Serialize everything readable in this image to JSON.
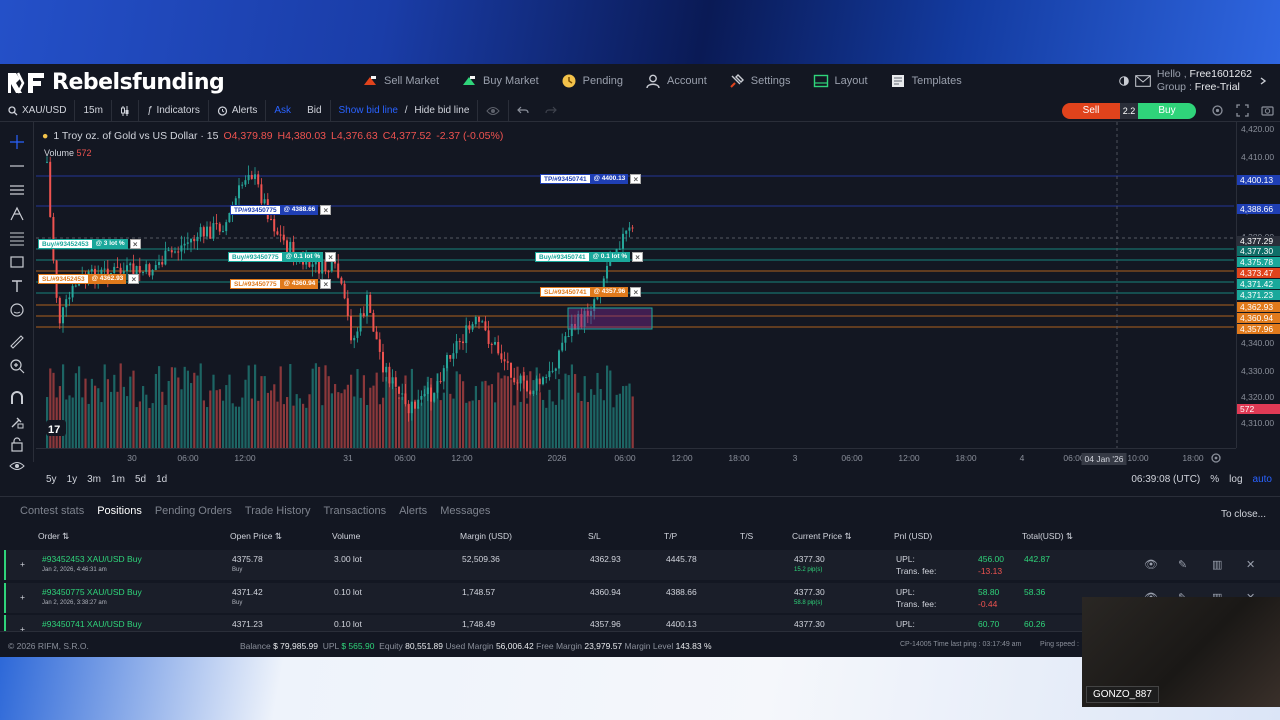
{
  "brand": {
    "name": "Rebelsfunding",
    "accent": "#2962ff"
  },
  "nav": [
    {
      "label": "Sell Market",
      "icon": "sell-market-icon"
    },
    {
      "label": "Buy Market",
      "icon": "buy-market-icon"
    },
    {
      "label": "Pending",
      "icon": "pending-icon"
    },
    {
      "label": "Account",
      "icon": "account-icon"
    },
    {
      "label": "Settings",
      "icon": "settings-icon"
    },
    {
      "label": "Layout",
      "icon": "layout-icon"
    },
    {
      "label": "Templates",
      "icon": "templates-icon"
    }
  ],
  "user": {
    "hello_label": "Hello , ",
    "name": "Free1601262",
    "group_label": "Group : ",
    "group": "Free-Trial"
  },
  "toolbar": {
    "symbol": "XAU/USD",
    "interval": "15m",
    "indicators": "Indicators",
    "alerts": "Alerts",
    "ask": "Ask",
    "bid": "Bid",
    "show_bid_line": "Show bid line",
    "separator": " / ",
    "hide_bid_line": "Hide bid line",
    "sell": "Sell",
    "spread": "2.2",
    "buy": "Buy"
  },
  "chart_header": {
    "title": "1 Troy oz. of Gold vs US Dollar · 15",
    "open": "O4,379.89",
    "high": "H4,380.03",
    "low": "L4,376.63",
    "close": "C4,377.52",
    "change": "-2.37 (-0.05%)",
    "volume_label": "Volume",
    "volume_value": "572"
  },
  "price_axis": {
    "ticks": [
      "4,420.00",
      "4,410.00",
      "4,390.00",
      "4,380.00",
      "4,340.00",
      "4,330.00",
      "4,320.00",
      "4,310.00"
    ],
    "tags": [
      {
        "text": "4,400.13",
        "color": "#1f3fb4"
      },
      {
        "text": "4,388.66",
        "color": "#1f3fb4"
      },
      {
        "text": "4,377.29",
        "color": "#2a2e39"
      },
      {
        "text": "4,377.30",
        "color": "#0f6e68"
      },
      {
        "text": "4,375.78",
        "color": "#1aa89b"
      },
      {
        "text": "4,373.47",
        "color": "#e0431c"
      },
      {
        "text": "4,371.42",
        "color": "#1aa89b"
      },
      {
        "text": "4,371.23",
        "color": "#1aa89b"
      },
      {
        "text": "4,362.93",
        "color": "#e07a1c"
      },
      {
        "text": "4,360.94",
        "color": "#e07a1c"
      },
      {
        "text": "4,357.96",
        "color": "#e07a1c"
      },
      {
        "text": "572",
        "color": "#e03a55"
      }
    ],
    "bid_label": "Bid"
  },
  "time_axis": {
    "ticks": [
      "30",
      "06:00",
      "12:00",
      "31",
      "06:00",
      "12:00",
      "2026",
      "06:00",
      "12:00",
      "18:00",
      "3",
      "06:00",
      "12:00",
      "18:00",
      "4",
      "06:00",
      "10:00",
      "18:00"
    ],
    "crosshair_label": "04 Jan '26"
  },
  "order_lines": [
    {
      "label": "TP/#93450741",
      "value": "@ 4400.13",
      "color": "#1f3fb4"
    },
    {
      "label": "TP/#93450775",
      "value": "@ 4388.66",
      "color": "#1f3fb4"
    },
    {
      "label": "Buy/#93452453",
      "value": "@ 3 lot %",
      "color": "#1aa89b"
    },
    {
      "label": "Buy/#93450775",
      "value": "@ 0.1 lot %",
      "color": "#1aa89b"
    },
    {
      "label": "Buy/#93450741",
      "value": "@ 0.1 lot %",
      "color": "#1aa89b"
    },
    {
      "label": "SL/#93452453",
      "value": "@ 4362.93",
      "color": "#e07a1c"
    },
    {
      "label": "SL/#93450775",
      "value": "@ 4360.94",
      "color": "#e07a1c"
    },
    {
      "label": "SL/#93450741",
      "value": "@ 4357.96",
      "color": "#e07a1c"
    }
  ],
  "range_bar": {
    "ranges": [
      "5y",
      "1y",
      "3m",
      "1m",
      "5d",
      "1d"
    ],
    "clock": "06:39:08 (UTC)",
    "percent": "%",
    "log": "log",
    "auto": "auto"
  },
  "panel": {
    "tabs": [
      "Contest stats",
      "Positions",
      "Pending Orders",
      "Trade History",
      "Transactions",
      "Alerts",
      "Messages"
    ],
    "active_tab": "Positions",
    "close_all": "To close...",
    "columns": [
      "Order",
      "Open Price",
      "Volume",
      "Margin (USD)",
      "S/L",
      "T/P",
      "T/S",
      "Current Price",
      "Pnl (USD)",
      "Total(USD)"
    ],
    "rows": [
      {
        "order": "#93452453 XAU/USD Buy",
        "time": "Jan 2, 2026, 4:46:31 am",
        "open_price": "4375.78",
        "side": "Buy",
        "volume": "3.00 lot",
        "margin": "52,509.36",
        "sl": "4362.93",
        "tp": "4445.78",
        "ts": "",
        "current": "4377.30",
        "pips": "15.2 pip(s)",
        "upl_label": "UPL:",
        "upl": "456.00",
        "fee_label": "Trans. fee:",
        "fee": "-13.13",
        "total": "442.87"
      },
      {
        "order": "#93450775 XAU/USD Buy",
        "time": "Jan 2, 2026, 3:38:27 am",
        "open_price": "4371.42",
        "side": "Buy",
        "volume": "0.10 lot",
        "margin": "1,748.57",
        "sl": "4360.94",
        "tp": "4388.66",
        "ts": "",
        "current": "4377.30",
        "pips": "58.8 pip(s)",
        "upl_label": "UPL:",
        "upl": "58.80",
        "fee_label": "Trans. fee:",
        "fee": "-0.44",
        "total": "58.36"
      },
      {
        "order": "#93450741 XAU/USD Buy",
        "time": "",
        "open_price": "4371.23",
        "side": "",
        "volume": "0.10 lot",
        "margin": "1,748.49",
        "sl": "4357.96",
        "tp": "4400.13",
        "ts": "",
        "current": "4377.30",
        "pips": "",
        "upl_label": "UPL:",
        "upl": "60.70",
        "fee_label": "",
        "fee": "",
        "total": "60.26"
      }
    ]
  },
  "footer": {
    "copyright": "© 2026 RIFM, S.R.O.",
    "balance_label": "Balance",
    "balance": "$ 79,985.99",
    "upl_label": "UPL",
    "upl": "$ 565.90",
    "equity_label": "Equity",
    "equity": "80,551.89",
    "used_margin_label": "Used Margin",
    "used_margin": "56,006.42",
    "free_margin_label": "Free Margin",
    "free_margin": "23,979.57",
    "margin_level_label": "Margin Level",
    "margin_level": "143.83 %",
    "server": "CP-14005 Time last ping : 03:17:49 am",
    "ping": "Ping speed :"
  },
  "webcam": {
    "name": "GONZO_887"
  }
}
